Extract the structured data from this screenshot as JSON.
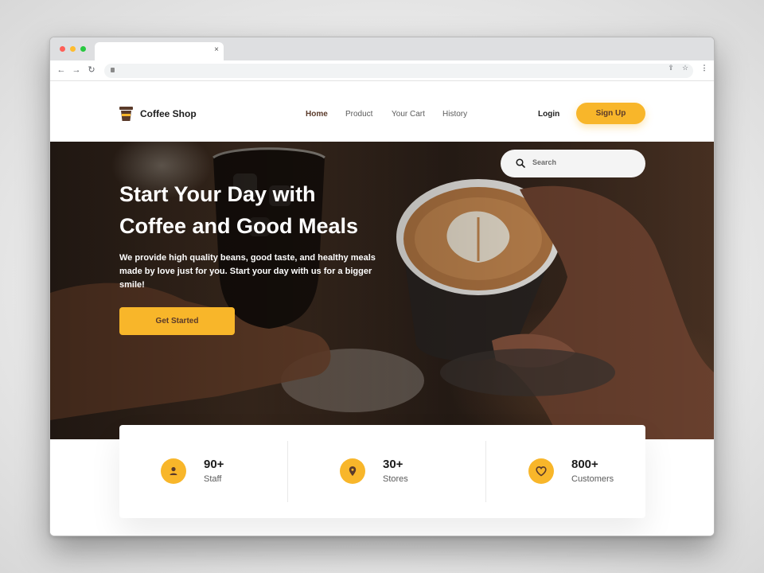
{
  "browser": {
    "tab_close": "×",
    "nav": {
      "back": "←",
      "forward": "→",
      "reload": "↻"
    },
    "icons": [
      "lock-icon",
      "share-icon",
      "star-icon",
      "menu-icon"
    ]
  },
  "header": {
    "logo_text": "Coffee Shop",
    "menu": [
      "Home",
      "Product",
      "Your Cart",
      "History"
    ],
    "active_menu": "Home",
    "login_label": "Login",
    "signup_label": "Sign Up"
  },
  "search": {
    "placeholder": "Search"
  },
  "hero": {
    "title_line1": "Start Your Day with",
    "title_line2": "Coffee and Good Meals",
    "description": "We provide high quality beans, good taste, and healthy meals made by love just for you. Start your day with us for a bigger smile!",
    "cta_label": "Get Started"
  },
  "stats": [
    {
      "value": "90+",
      "label": "Staff",
      "icon": "user-icon"
    },
    {
      "value": "30+",
      "label": "Stores",
      "icon": "location-pin-icon"
    },
    {
      "value": "800+",
      "label": "Customers",
      "icon": "heart-icon"
    }
  ],
  "colors": {
    "accent": "#f8b62a",
    "brand_brown": "#5a3a2a",
    "text_dark": "#1c1c1c",
    "text_muted": "#5b5b5b"
  }
}
